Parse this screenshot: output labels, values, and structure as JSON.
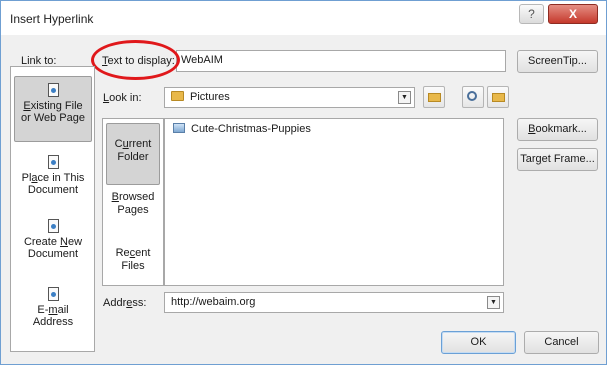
{
  "window": {
    "title": "Insert Hyperlink",
    "help_glyph": "?",
    "close_glyph": "X"
  },
  "link_to": {
    "label": "Link to:",
    "items": [
      {
        "label_line1": "Existing File",
        "label_line2": "or Web Page",
        "icon": "web-page-icon",
        "selected": true
      },
      {
        "label_line1": "Place in This",
        "label_line2": "Document",
        "icon": "document-place-icon",
        "selected": false
      },
      {
        "label_line1": "Create New",
        "label_line2": "Document",
        "icon": "new-document-icon",
        "selected": false
      },
      {
        "label_line1": "E-mail",
        "label_line2": "Address",
        "icon": "email-icon",
        "selected": false
      }
    ]
  },
  "text_to_display": {
    "label": "Text to display:",
    "value": "WebAIM"
  },
  "look_in": {
    "label": "Look in:",
    "value": "Pictures",
    "items": [
      {
        "label_line1": "Current",
        "label_line2": "Folder",
        "selected": true
      },
      {
        "label_line1": "Browsed",
        "label_line2": "Pages",
        "selected": false
      },
      {
        "label_line1": "Recent",
        "label_line2": "Files",
        "selected": false
      }
    ]
  },
  "files": [
    "Cute-Christmas-Puppies"
  ],
  "address": {
    "label": "Address:",
    "value": "http://webaim.org"
  },
  "buttons": {
    "screentip": "ScreenTip...",
    "bookmark": "Bookmark...",
    "target_frame": "Target Frame...",
    "ok": "OK",
    "cancel": "Cancel"
  },
  "colors": {
    "annotation": "#e0181b",
    "title_bar": "#ffffff",
    "close_button": "#c5392c"
  }
}
